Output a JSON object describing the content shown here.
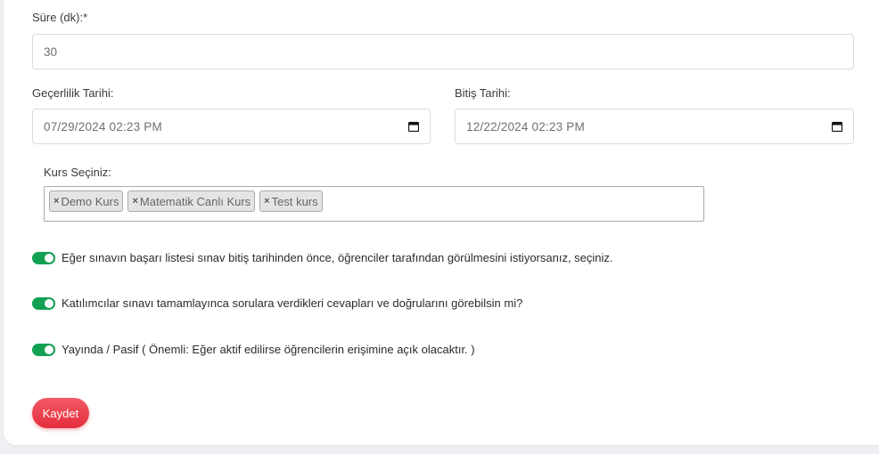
{
  "duration": {
    "label": "Süre (dk):*",
    "value": "30"
  },
  "validity_date": {
    "label": "Geçerlilik Tarihi:",
    "value": "07/29/2024 02:23 PM"
  },
  "end_date": {
    "label": "Bitiş Tarihi:",
    "value": "12/22/2024 02:23 PM"
  },
  "courses": {
    "label": "Kurs Seçiniz:",
    "remove_symbol": "×",
    "tags": [
      "Demo Kurs",
      "Matematik Canlı Kurs",
      "Test kurs"
    ]
  },
  "toggles": [
    {
      "label": "Eğer sınavın başarı listesi sınav bitiş tarihinden önce, öğrenciler tarafından görülmesini istiyorsanız, seçiniz.",
      "on": true
    },
    {
      "label": "Katılımcılar sınavı tamamlayınca sorulara verdikleri cevapları ve doğrularını görebilsin mi?",
      "on": true
    },
    {
      "label": "Yayında / Pasif ( Önemli: Eğer aktif edilirse öğrencilerin erişimine açık olacaktır. )",
      "on": true
    }
  ],
  "save_button": {
    "label": "Kaydet"
  },
  "colors": {
    "toggle_on": "#12a152",
    "save_button": "#e52d3c"
  }
}
